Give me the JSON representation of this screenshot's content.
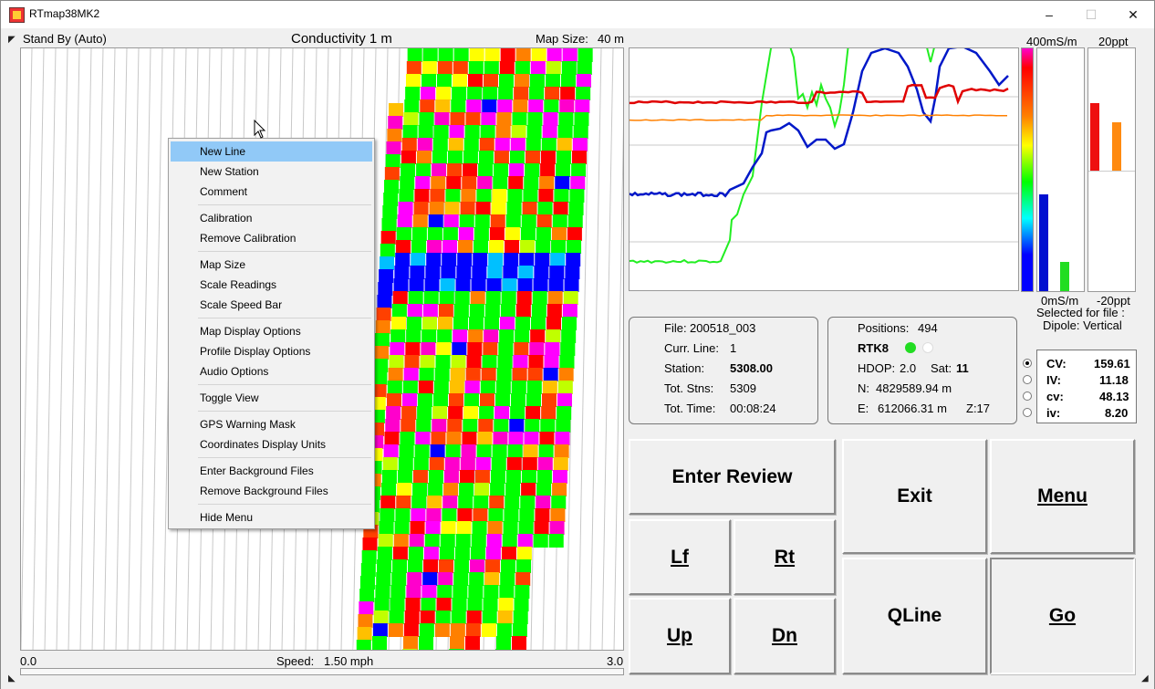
{
  "window": {
    "title": "RTmap38MK2",
    "controls": [
      "–",
      "☐",
      "✕"
    ]
  },
  "header": {
    "status": "Stand By (Auto)",
    "map_title": "Conductivity 1 m",
    "map_size_label": "Map Size:",
    "map_size_value": "40 m"
  },
  "speed": {
    "min": "0.0",
    "label": "Speed:",
    "value": "1.50 mph",
    "max": "3.0"
  },
  "context_menu": {
    "highlighted": "New Line",
    "groups": [
      [
        "New Line",
        "New Station",
        "Comment"
      ],
      [
        "Calibration",
        "Remove Calibration"
      ],
      [
        "Map Size",
        "Scale Readings",
        "Scale Speed Bar"
      ],
      [
        "Map Display Options",
        "Profile Display Options",
        "Audio Options"
      ],
      [
        "Toggle View"
      ],
      [
        "GPS Warning Mask",
        "Coordinates Display Units"
      ],
      [
        "Enter Background Files",
        "Remove Background Files"
      ],
      [
        "Hide Menu"
      ]
    ]
  },
  "scales": {
    "conductivity_max": "400mS/m",
    "conductivity_min": "0mS/m",
    "inphase_max": "20ppt",
    "inphase_min": "-20ppt",
    "selected_label": "Selected for file :",
    "dipole_label": "Dipole: Vertical"
  },
  "bars": {
    "cond_blue": 0.4,
    "cond_green": 0.12,
    "ip_red": 0.78,
    "ip_orange": 0.7
  },
  "file_info": {
    "file_label": "File:",
    "file_value": "200518_003",
    "line_label": "Curr. Line:",
    "line_value": "1",
    "station_label": "Station:",
    "station_value": "5308.00",
    "stns_label": "Tot. Stns:",
    "stns_value": "5309",
    "time_label": "Tot. Time:",
    "time_value": "00:08:24"
  },
  "gps_info": {
    "positions_label": "Positions:",
    "positions_value": "494",
    "mode": "RTK8",
    "hdop_label": "HDOP:",
    "hdop_value": "2.0",
    "sat_label": "Sat:",
    "sat_value": "11",
    "n_label": "N:",
    "n_value": "4829589.94 m",
    "e_label": "E:",
    "e_value": "612066.31 m",
    "zone": "Z:17"
  },
  "readings": [
    {
      "label": "CV:",
      "value": "159.61",
      "selected": true
    },
    {
      "label": "IV:",
      "value": "11.18",
      "selected": false
    },
    {
      "label": "cv:",
      "value": "48.13",
      "selected": false
    },
    {
      "label": "iv:",
      "value": "8.20",
      "selected": false
    }
  ],
  "buttons": {
    "enter_review": "Enter Review",
    "exit": "Exit",
    "menu": "Menu",
    "lf": "Lf",
    "rt": "Rt",
    "up": "Up",
    "dn": "Dn",
    "qline": "QLine",
    "go": "Go"
  },
  "colors": {
    "menu_highlight": "#91c9f7",
    "cond_line": "#e00000",
    "ip_line": "#ff8000",
    "cv_line": "#0018c8",
    "iv_line": "#22ee22"
  }
}
